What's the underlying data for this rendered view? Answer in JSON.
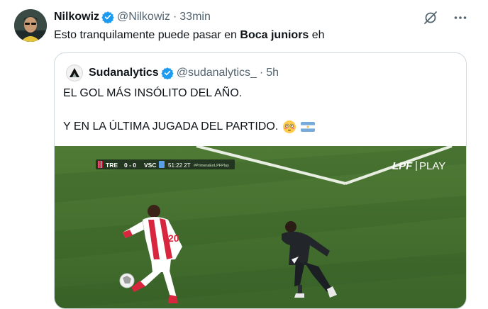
{
  "tweet": {
    "author_name": "Nilkowiz",
    "handle": "@Nilkowiz",
    "separator": "·",
    "time": "33min",
    "text_before": "Esto tranquilamente puede pasar en ",
    "text_bold": "Boca juniors",
    "text_after": " eh",
    "icons": [
      "grok-icon",
      "more-icon"
    ]
  },
  "quote": {
    "author_name": "Sudanalytics",
    "handle": "@sudanalytics_",
    "separator": "·",
    "time": "5h",
    "line1": "EL GOL MÁS INSÓLITO DEL AÑO.",
    "line2": "Y EN LA ÚLTIMA JUGADA DEL PARTIDO.",
    "emojis": [
      "flushed-face-emoji",
      "argentina-flag-emoji"
    ]
  },
  "media": {
    "scorebug": {
      "home": "TRE",
      "score": "0 - 0",
      "away": "VSC",
      "clock": "51:22 2T",
      "tag": "#PrimeraEnLPFPlay"
    },
    "broadcaster": "LPF",
    "broadcaster_suffix": "PLAY",
    "player_number": "20"
  },
  "colors": {
    "accent": "#1d9bf0",
    "muted": "#536471",
    "pitch": "#3f6b2e"
  }
}
